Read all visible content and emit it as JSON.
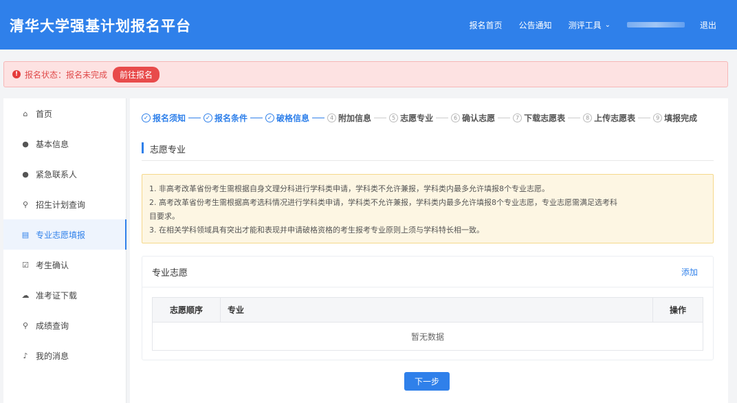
{
  "header": {
    "title": "清华大学强基计划报名平台",
    "nav": {
      "home": "报名首页",
      "notice": "公告通知",
      "tools": "测评工具",
      "logout": "退出"
    }
  },
  "alert": {
    "status": "报名状态：报名未完成",
    "button": "前往报名"
  },
  "sidebar": {
    "items": [
      {
        "label": "首页",
        "icon": "home-icon"
      },
      {
        "label": "基本信息",
        "icon": "user-icon"
      },
      {
        "label": "紧急联系人",
        "icon": "user-icon"
      },
      {
        "label": "招生计划查询",
        "icon": "search-icon"
      },
      {
        "label": "专业志愿填报",
        "icon": "document-icon"
      },
      {
        "label": "考生确认",
        "icon": "checkbox-icon"
      },
      {
        "label": "准考证下载",
        "icon": "cloud-download-icon"
      },
      {
        "label": "成绩查询",
        "icon": "search-icon"
      },
      {
        "label": "我的消息",
        "icon": "bell-icon"
      }
    ],
    "active_index": 4
  },
  "steps": [
    {
      "num": "✓",
      "label": "报名须知",
      "done": true
    },
    {
      "num": "✓",
      "label": "报名条件",
      "done": true
    },
    {
      "num": "✓",
      "label": "破格信息",
      "done": true
    },
    {
      "num": "4",
      "label": "附加信息",
      "done": false
    },
    {
      "num": "5",
      "label": "志愿专业",
      "done": false
    },
    {
      "num": "6",
      "label": "确认志愿",
      "done": false
    },
    {
      "num": "7",
      "label": "下载志愿表",
      "done": false
    },
    {
      "num": "8",
      "label": "上传志愿表",
      "done": false
    },
    {
      "num": "9",
      "label": "填报完成",
      "done": false
    }
  ],
  "section_title": "志愿专业",
  "notice": {
    "line1": "1. 非高考改革省份考生需根据自身文理分科进行学科类申请，学科类不允许兼报，学科类内最多允许填报8个专业志愿。",
    "line2": "2. 高考改革省份考生需根据高考选科情况进行学科类申请，学科类不允许兼报，学科类内最多允许填报8个专业志愿，专业志愿需满足选考科",
    "line2b": "目要求。",
    "line3": "3. 在相关学科领域具有突出才能和表现并申请破格资格的考生报考专业原则上须与学科特长相一致。"
  },
  "card": {
    "title": "专业志愿",
    "add_label": "添加",
    "table": {
      "columns": [
        "志愿顺序",
        "专业",
        "操作"
      ],
      "empty_text": "暂无数据"
    }
  },
  "next_button": "下一步",
  "colors": {
    "primary": "#2f80ea",
    "danger": "#e84b4b",
    "notice_bg": "#fdf6e3"
  }
}
